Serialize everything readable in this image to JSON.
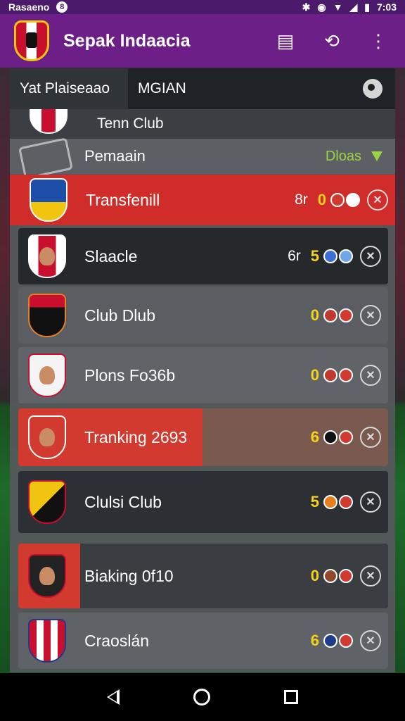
{
  "status_bar": {
    "carrier": "Rasaeno",
    "notif_icon": "circle-8",
    "time": "7:03"
  },
  "app_bar": {
    "title": "Sepak Indaacia",
    "actions": [
      "table-icon",
      "share-icon",
      "more-vert-icon"
    ]
  },
  "filter_bar": {
    "tab_primary": "Yat Plaiseaao",
    "tab_secondary": "MGIAN",
    "search_icon": "search-icon"
  },
  "partial_row": {
    "name": "Tenn Club"
  },
  "section": {
    "title": "Pemaain",
    "filter_label": "Dloas"
  },
  "rows": [
    {
      "name": "Transfenill",
      "pos": "8r",
      "score": "0",
      "highlight": "full",
      "balls": [
        "#d23a2f",
        "#ffffff"
      ]
    },
    {
      "name": "Slaacle",
      "pos": "6r",
      "score": "5",
      "highlight": "none",
      "balls": [
        "#3b6fd6",
        "#6fa6e8"
      ]
    },
    {
      "name": "Club Dlub",
      "pos": "",
      "score": "0",
      "highlight": "none",
      "balls": [
        "#c0392b",
        "#d23a2f"
      ]
    },
    {
      "name": "Plons Fo36b",
      "pos": "",
      "score": "0",
      "highlight": "none",
      "balls": [
        "#c0392b",
        "#d23a2f"
      ]
    },
    {
      "name": "Tranking 2693",
      "pos": "",
      "score": "6",
      "highlight": "half",
      "balls": [
        "#111111",
        "#d23a2f"
      ]
    },
    {
      "name": "Clulsi Club",
      "pos": "",
      "score": "5",
      "highlight": "none",
      "balls": [
        "#e67e22",
        "#d23a2f"
      ]
    },
    {
      "name": "Biaking 0f10",
      "pos": "",
      "score": "0",
      "highlight": "left",
      "balls": [
        "#8e4a2a",
        "#d23a2f"
      ]
    },
    {
      "name": "Craoslán",
      "pos": "",
      "score": "6",
      "highlight": "none",
      "balls": [
        "#1f3c88",
        "#d23a2f"
      ]
    }
  ],
  "colors": {
    "app_bar": "#6c1f86",
    "accent_red": "#d23a2f",
    "score_yellow": "#f6d31b",
    "filter_green": "#9bd342"
  }
}
